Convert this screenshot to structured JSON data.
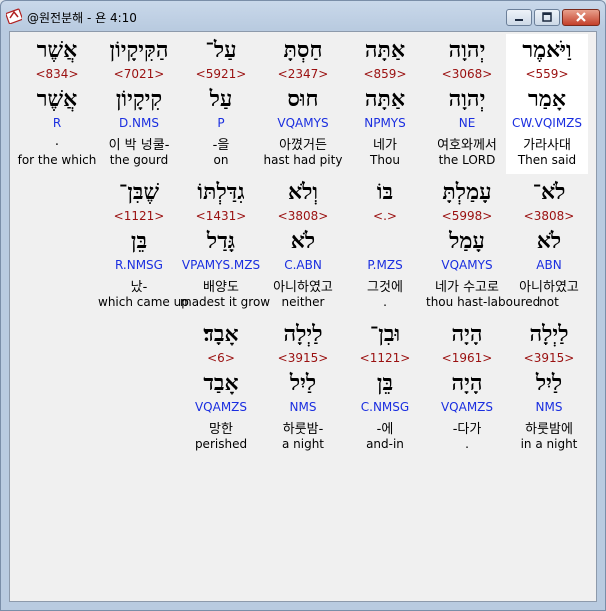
{
  "window": {
    "title": "@원전분해 - 욘 4:10"
  },
  "rows": [
    [
      {
        "heb": "וַיֹּאמֶר",
        "strong": "<559>",
        "root": "אָמַר",
        "parse": "CW.VQIMZS",
        "kor": "가라사대",
        "eng": "Then said",
        "highlight": true
      },
      {
        "heb": "יְהוָה",
        "strong": "<3068>",
        "root": "יְהוָה",
        "parse": "NE",
        "kor": "여호와께서",
        "eng": "the LORD"
      },
      {
        "heb": "אַתָּה",
        "strong": "<859>",
        "root": "אַתָּה",
        "parse": "NPMYS",
        "kor": "네가",
        "eng": "Thou"
      },
      {
        "heb": "חַסְתָּ",
        "strong": "<2347>",
        "root": "חוּס",
        "parse": "VQAMYS",
        "kor": "아꼈거든",
        "eng": "hast had pity"
      },
      {
        "heb": "עַל־",
        "strong": "<5921>",
        "root": "עַל",
        "parse": "P",
        "kor": "-을",
        "eng": "on"
      },
      {
        "heb": "הַקִּיקָיוֹן",
        "strong": "<7021>",
        "root": "קִיקָיוֹן",
        "parse": "D.NMS",
        "kor": "이 박 넝쿨-",
        "eng": "the gourd"
      },
      {
        "heb": "אֲשֶׁר",
        "strong": "<834>",
        "root": "אֲשֶׁר",
        "parse": "R",
        "kor": ".",
        "eng": "for the which"
      }
    ],
    [
      {
        "heb": "לֹא־",
        "strong": "<3808>",
        "root": "לֹא",
        "parse": "ABN",
        "kor": "아니하였고",
        "eng": "not"
      },
      {
        "heb": "עָמַלְתָּ",
        "strong": "<5998>",
        "root": "עָמַל",
        "parse": "VQAMYS",
        "kor": "네가 수고로",
        "eng": "thou hast-laboured"
      },
      {
        "heb": "בּוֹ",
        "strong": "<.>",
        "root": "",
        "parse": "P.MZS",
        "kor": "그것에",
        "eng": "."
      },
      {
        "heb": "וְלֹא",
        "strong": "<3808>",
        "root": "לֹא",
        "parse": "C.ABN",
        "kor": "아니하였고",
        "eng": "neither"
      },
      {
        "heb": "גִדַּלְתּוֹ",
        "strong": "<1431>",
        "root": "גָּדַל",
        "parse": "VPAMYS.MZS",
        "kor": "배양도",
        "eng": "madest it grow"
      },
      {
        "heb": "שֶׁבִּן־",
        "strong": "<1121>",
        "root": "בֵּן",
        "parse": "R.NMSG",
        "kor": "났-",
        "eng": "which came up"
      }
    ],
    [
      {
        "heb": "לַיְלָה",
        "strong": "<3915>",
        "root": "לַיִל",
        "parse": "NMS",
        "kor": "하룻밤에",
        "eng": "in a night"
      },
      {
        "heb": "הָיָה",
        "strong": "<1961>",
        "root": "הָיָה",
        "parse": "VQAMZS",
        "kor": "-다가",
        "eng": "."
      },
      {
        "heb": "וּבִן־",
        "strong": "<1121>",
        "root": "בֵּן",
        "parse": "C.NMSG",
        "kor": "-에",
        "eng": "and-in"
      },
      {
        "heb": "לַיְלָה",
        "strong": "<3915>",
        "root": "לַיִל",
        "parse": "NMS",
        "kor": "하룻밤-",
        "eng": "a night"
      },
      {
        "heb": "אָבָד׃",
        "strong": "<6>",
        "root": "אָבַד",
        "parse": "VQAMZS",
        "kor": "망한",
        "eng": "perished"
      }
    ]
  ]
}
